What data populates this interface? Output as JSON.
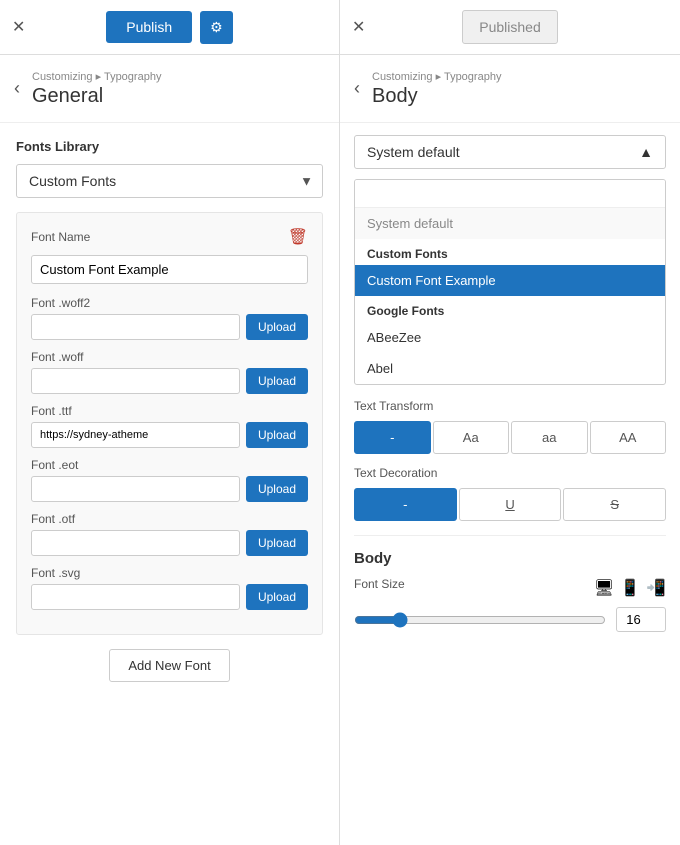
{
  "topbar": {
    "left": {
      "close_label": "✕",
      "publish_label": "Publish",
      "gear_label": "⚙"
    },
    "right": {
      "close_label": "✕",
      "published_label": "Published"
    }
  },
  "panel_left": {
    "breadcrumb_nav": "Customizing ▸ Typography",
    "breadcrumb_title": "General",
    "fonts_library_label": "Fonts Library",
    "dropdown_value": "Custom Fonts",
    "dropdown_chevron": "▼",
    "font_card": {
      "font_name_label": "Font Name",
      "delete_icon": "🗑",
      "font_name_value": "Custom Font Example",
      "font_woff2_label": "Font .woff2",
      "font_woff2_value": "",
      "font_woff_label": "Font .woff",
      "font_woff_value": "",
      "font_ttf_label": "Font .ttf",
      "font_ttf_value": "https://sydney-atheme",
      "font_eot_label": "Font .eot",
      "font_eot_value": "",
      "font_otf_label": "Font .otf",
      "font_otf_value": "",
      "font_svg_label": "Font .svg",
      "font_svg_value": "",
      "upload_label": "Upload"
    },
    "add_new_font_label": "Add New Font"
  },
  "panel_right": {
    "breadcrumb_nav": "Customizing ▸ Typography",
    "breadcrumb_title": "Body",
    "font_selector_value": "System default",
    "font_selector_chevron": "▲",
    "font_search_placeholder": "",
    "font_options": {
      "system_default": "System default",
      "custom_fonts_header": "Custom Fonts",
      "custom_font_example": "Custom Font Example",
      "google_fonts_header": "Google Fonts",
      "google_font_1": "ABeeZee",
      "google_font_2": "Abel"
    },
    "text_transform_label": "Text Transform",
    "transforms": [
      "-",
      "Aa",
      "aa",
      "AA"
    ],
    "text_decoration_label": "Text Decoration",
    "decorations": [
      "-",
      "U",
      "S"
    ],
    "body_section": {
      "title": "Body",
      "font_size_label": "Font Size",
      "slider_value": 16,
      "slider_min": 0,
      "slider_max": 100
    }
  }
}
